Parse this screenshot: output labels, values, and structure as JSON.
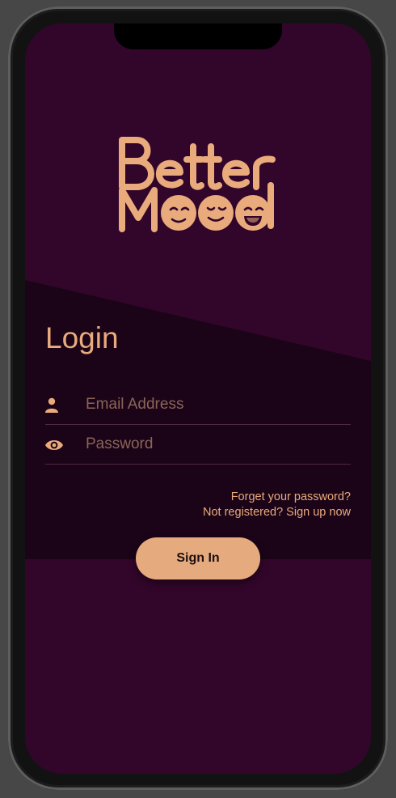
{
  "logo": {
    "text": "BetterMood",
    "color": "#e9aa7c"
  },
  "login": {
    "title": "Login",
    "email": {
      "placeholder": "Email Address",
      "value": "",
      "icon": "person-icon"
    },
    "password": {
      "placeholder": "Password",
      "value": "",
      "icon": "eye-icon"
    },
    "forgot_link": "Forget your password?",
    "signup_link": "Not registered? Sign up now",
    "signin_label": "Sign In"
  },
  "colors": {
    "background": "#32062a",
    "panel": "#1b0417",
    "accent": "#e9aa7c",
    "button": "#e5aa7e"
  }
}
